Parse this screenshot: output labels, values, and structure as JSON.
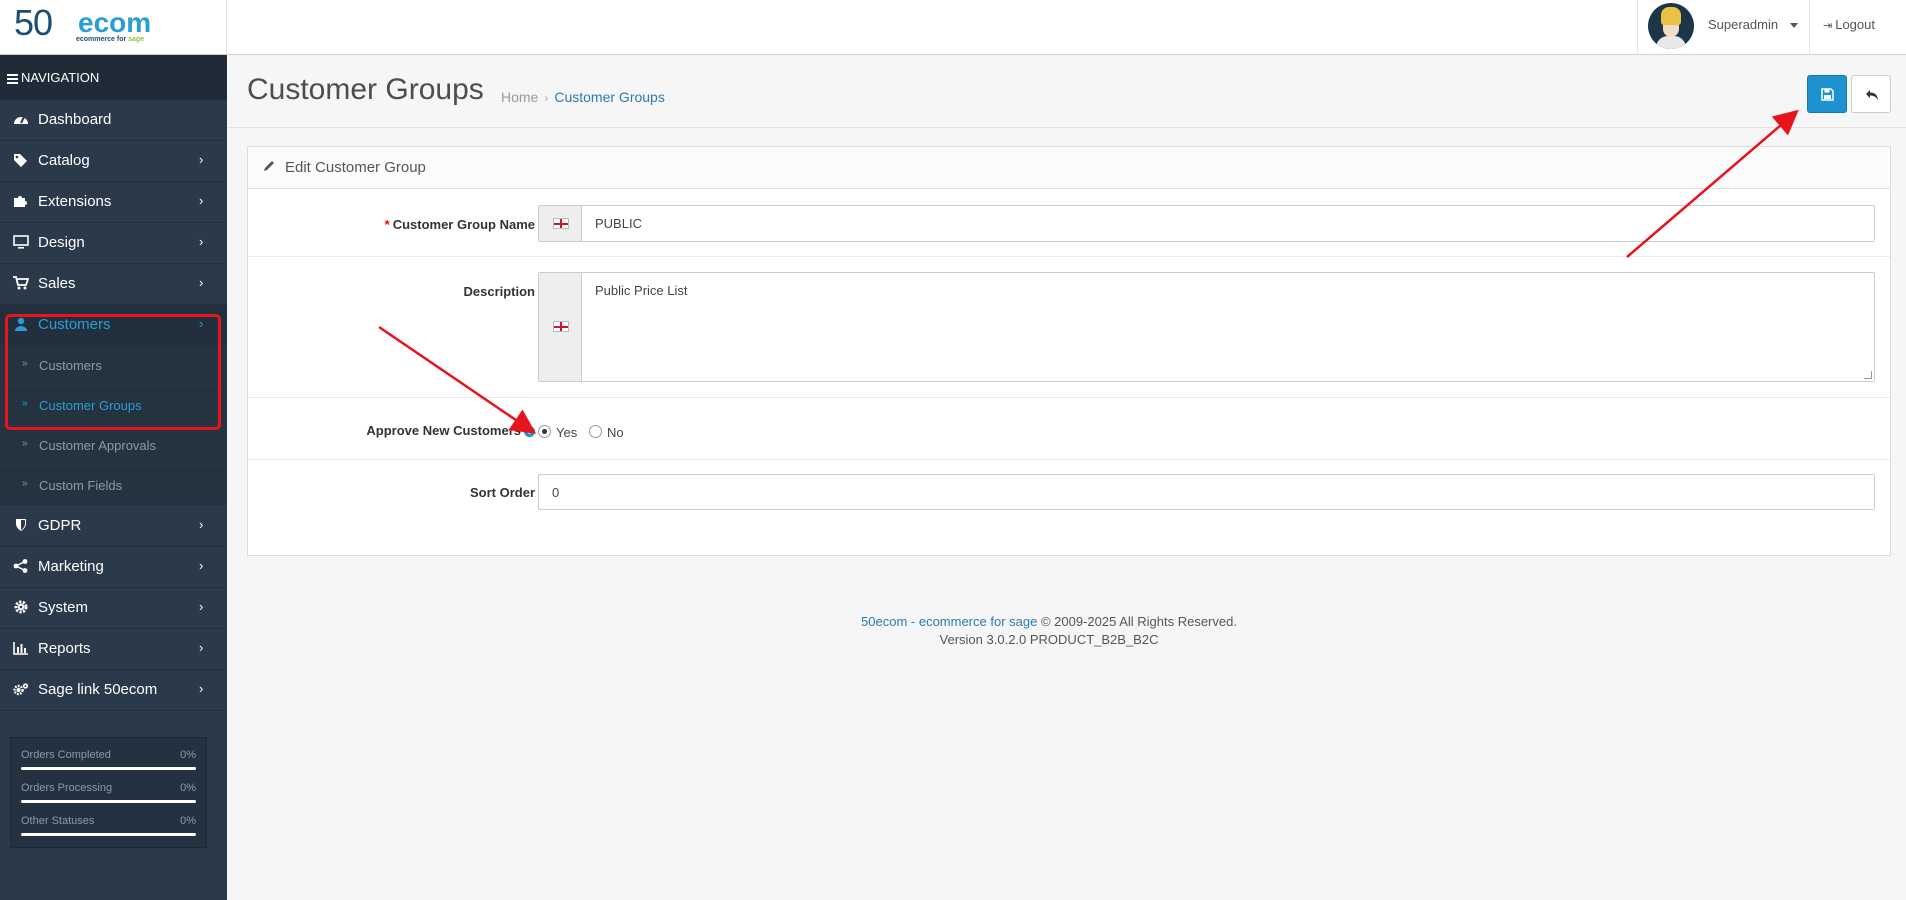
{
  "header": {
    "logo_num": "50",
    "logo_word": "ecom",
    "logo_tagline_a": "ecommerce for ",
    "logo_tagline_b": "sage",
    "user_name": "Superadmin",
    "logout_label": "Logout"
  },
  "sidebar": {
    "nav_title": "NAVIGATION",
    "items": [
      {
        "label": "Dashboard",
        "icon": "dashboard-icon"
      },
      {
        "label": "Catalog",
        "icon": "tags-icon"
      },
      {
        "label": "Extensions",
        "icon": "puzzle-icon"
      },
      {
        "label": "Design",
        "icon": "monitor-icon"
      },
      {
        "label": "Sales",
        "icon": "cart-icon"
      },
      {
        "label": "Customers",
        "icon": "user-icon"
      },
      {
        "label": "GDPR",
        "icon": "shield-icon"
      },
      {
        "label": "Marketing",
        "icon": "share-icon"
      },
      {
        "label": "System",
        "icon": "gear-icon"
      },
      {
        "label": "Reports",
        "icon": "bar-chart-icon"
      },
      {
        "label": "Sage link 50ecom",
        "icon": "gears-icon"
      }
    ],
    "customers_sub": [
      {
        "label": "Customers"
      },
      {
        "label": "Customer Groups"
      },
      {
        "label": "Customer Approvals"
      },
      {
        "label": "Custom Fields"
      }
    ],
    "stats": [
      {
        "label": "Orders Completed",
        "value": "0%",
        "fill": 0
      },
      {
        "label": "Orders Processing",
        "value": "0%",
        "fill": 0
      },
      {
        "label": "Other Statuses",
        "value": "0%",
        "fill": 0
      }
    ]
  },
  "page": {
    "title": "Customer Groups",
    "breadcrumb_home": "Home",
    "breadcrumb_sep": "›",
    "breadcrumb_current": "Customer Groups"
  },
  "form": {
    "panel_title": "Edit Customer Group",
    "name_required": "*",
    "name_label": "Customer Group Name",
    "name_value": "PUBLIC",
    "description_label": "Description",
    "description_value": "Public Price List",
    "approve_label": "Approve New Customers",
    "help_symbol": "?",
    "approve_yes": "Yes",
    "approve_no": "No",
    "approve_selected": "Yes",
    "sort_label": "Sort Order",
    "sort_value": "0"
  },
  "footer": {
    "brand": "50ecom - ecommerce for sage",
    "copyright": " © 2009-2025 All Rights Reserved.",
    "version": "Version 3.0.2.0 PRODUCT_B2B_B2C"
  },
  "colors": {
    "accent": "#1e91cf",
    "sidebar_bg": "#2b3a4a",
    "highlight_red": "#e8141d"
  }
}
